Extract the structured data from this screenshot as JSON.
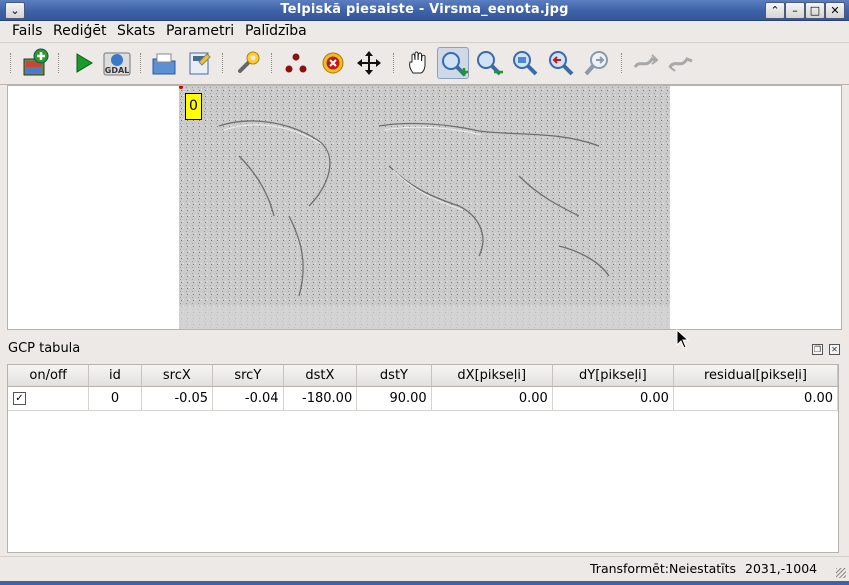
{
  "window": {
    "title": "Telpiskā piesaiste - Virsma_eenota.jpg",
    "controls": {
      "menu": "⌄",
      "shade": "⌃",
      "minimize": "–",
      "maximize": "□",
      "close": "✕"
    }
  },
  "menubar": {
    "items": [
      {
        "label": "Fails"
      },
      {
        "label": "Rediģēt"
      },
      {
        "label": "Skats"
      },
      {
        "label": "Parametri"
      },
      {
        "label": "Palīdzība"
      }
    ]
  },
  "toolbar": {
    "buttons": [
      {
        "icon": "open-raster-icon"
      },
      {
        "icon": "start-georeferencing-icon"
      },
      {
        "icon": "generate-gdal-script-icon",
        "text": "GDAL"
      },
      {
        "icon": "load-gcp-points-icon"
      },
      {
        "icon": "save-gcp-points-icon"
      },
      {
        "icon": "transformation-settings-icon"
      },
      {
        "icon": "add-point-icon"
      },
      {
        "icon": "delete-point-icon"
      },
      {
        "icon": "move-gcp-point-icon"
      },
      {
        "icon": "pan-icon"
      },
      {
        "icon": "zoom-in-icon",
        "active": true
      },
      {
        "icon": "zoom-out-icon"
      },
      {
        "icon": "zoom-to-layer-icon"
      },
      {
        "icon": "zoom-last-icon"
      },
      {
        "icon": "zoom-next-icon"
      },
      {
        "icon": "link-georeferencer-to-qgis-icon",
        "disabled": true
      },
      {
        "icon": "link-qgis-to-georeferencer-icon",
        "disabled": true
      }
    ]
  },
  "canvas": {
    "gcp_marker_label": "0"
  },
  "gcp_panel": {
    "title": "GCP tabula",
    "columns": [
      "on/off",
      "id",
      "srcX",
      "srcY",
      "dstX",
      "dstY",
      "dX[pikseļi]",
      "dY[pikseļi]",
      "residual[pikseļi]"
    ],
    "rows": [
      {
        "enabled": true,
        "id": "0",
        "srcX": "-0.05",
        "srcY": "-0.04",
        "dstX": "-180.00",
        "dstY": "90.00",
        "dX": "0.00",
        "dY": "0.00",
        "residual": "0.00"
      }
    ]
  },
  "statusbar": {
    "transform": "Transformēt:Neiestatīts",
    "coordinates": "2031,-1004"
  },
  "colors": {
    "titlebar": "#3e62a8",
    "gcp_label_bg": "#ffff00",
    "window_bg": "#ece9e6"
  }
}
